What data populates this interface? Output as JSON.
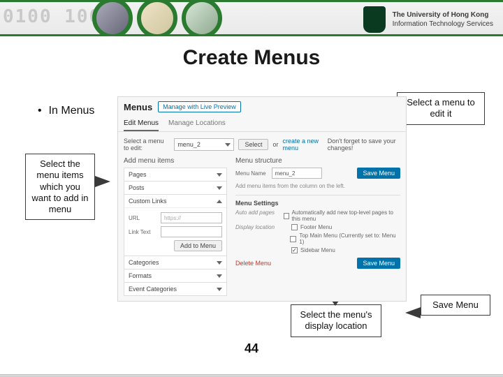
{
  "header": {
    "binary": "0100    10001",
    "logo_line1": "The University of Hong Kong",
    "logo_line2": "Information Technology Services"
  },
  "title": "Create Menus",
  "bullet": "In Menus",
  "callouts": {
    "select_menu": "Select a menu to edit it",
    "select_items": "Select the menu items which you want to add in menu",
    "display_location": "Select the menu's display location",
    "save_menu": "Save Menu"
  },
  "wp": {
    "heading": "Menus",
    "live_preview_btn": "Manage with Live Preview",
    "tabs": {
      "edit": "Edit Menus",
      "locations": "Manage Locations"
    },
    "select_label": "Select a menu to edit:",
    "select_value": "menu_2",
    "select_btn": "Select",
    "or": "or",
    "create_link": "create a new menu",
    "save_hint": "Don't forget to save your changes!",
    "add_title": "Add menu items",
    "structure_title": "Menu structure",
    "menu_name_label": "Menu Name",
    "menu_name_value": "menu_2",
    "save_btn": "Save Menu",
    "structure_hint": "Add menu items from the column on the left.",
    "accordion": {
      "pages": "Pages",
      "posts": "Posts",
      "custom": "Custom Links",
      "url_label": "URL",
      "url_value": "https://",
      "linktext_label": "Link Text",
      "add_btn": "Add to Menu",
      "categories": "Categories",
      "formats": "Formats",
      "event_categories": "Event Categories"
    },
    "settings": {
      "title": "Menu Settings",
      "auto_label": "Auto add pages",
      "auto_opt": "Automatically add new top-level pages to this menu",
      "loc_label": "Display location",
      "loc1": "Footer Menu",
      "loc2": "Top Main Menu (Currently set to: Menu 1)",
      "loc3": "Sidebar Menu"
    },
    "delete": "Delete Menu",
    "save_btn2": "Save Menu"
  },
  "page_number": "44"
}
